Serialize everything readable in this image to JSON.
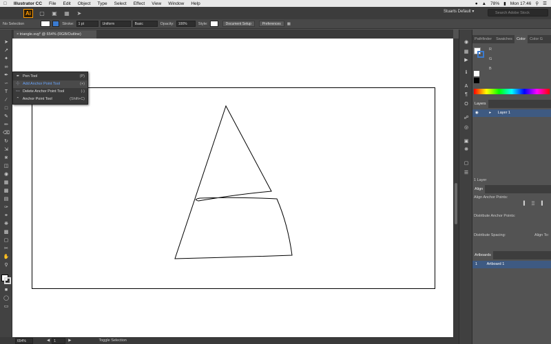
{
  "menubar": {
    "apple": "",
    "app_name": "Illustrator CC",
    "items": [
      "File",
      "Edit",
      "Object",
      "Type",
      "Select",
      "Effect",
      "View",
      "Window",
      "Help"
    ],
    "battery": "78%",
    "clock": "Mon 17:46"
  },
  "appbar": {
    "logo": "Ai",
    "workspace": "Stuarts Default",
    "search_placeholder": "Search Adobe Stock"
  },
  "controlbar": {
    "selection": "No Selection",
    "stroke_label": "Stroke:",
    "stroke_value": "1 pt",
    "profile": "Uniform",
    "brush": "Basic",
    "opacity_label": "Opacity:",
    "opacity_value": "100%",
    "style_label": "Style:",
    "doc_setup": "Document Setup",
    "preferences": "Preferences"
  },
  "document": {
    "tab_title": "triangle.svg* @ 654% (RGB/Outline)"
  },
  "flyout": {
    "items": [
      {
        "label": "Pen Tool",
        "shortcut": "(P)"
      },
      {
        "label": "Add Anchor Point Tool",
        "shortcut": "(+)"
      },
      {
        "label": "Delete Anchor Point Tool",
        "shortcut": "(-)"
      },
      {
        "label": "Anchor Point Tool",
        "shortcut": "(Shift+C)"
      }
    ]
  },
  "statusbar": {
    "zoom": "654%",
    "artboard_num": "1",
    "status": "Toggle Selection"
  },
  "panels": {
    "color_tabs": [
      "Pathfinder",
      "Swatches",
      "Color",
      "Color G"
    ],
    "color_sliders": [
      "R",
      "G",
      "B"
    ],
    "layers_tab": "Layers",
    "layer_name": "Layer 1",
    "layer_count": "1 Layer",
    "align_tab": "Align",
    "align_anchor": "Align Anchor Points:",
    "distribute_anchor": "Distribute Anchor Points:",
    "distribute_spacing": "Distribute Spacing:",
    "align_to": "Align To:",
    "artboards_tab": "Artboards",
    "artboard_index": "1",
    "artboard_name": "Artboard 1"
  },
  "colors": {
    "accent": "#ff9a00",
    "selection_blue": "#3e5a82"
  }
}
